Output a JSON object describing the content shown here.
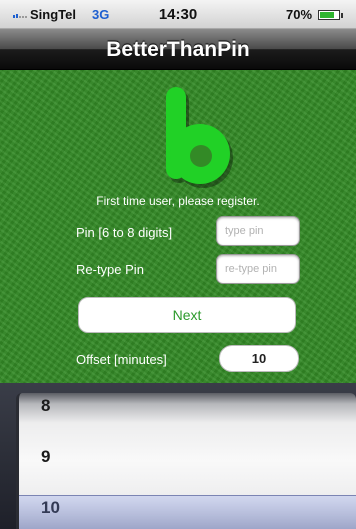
{
  "status_bar": {
    "carrier": "SingTel",
    "network": "3G",
    "time": "14:30",
    "battery": "70%",
    "battery_level": 0.7
  },
  "nav": {
    "title": "BetterThanPin"
  },
  "logo": {
    "icon": "app-logo-b",
    "color": "#21d126"
  },
  "form": {
    "register_message": "First time user, please register.",
    "pin_label": "Pin [6 to 8 digits]",
    "pin_placeholder": "type pin",
    "retype_label": "Re-type Pin",
    "retype_placeholder": "re-type pin",
    "next_label": "Next",
    "offset_label": "Offset [minutes]",
    "offset_value": "10"
  },
  "picker": {
    "items": [
      "8",
      "9",
      "10"
    ],
    "selected": "10"
  },
  "colors": {
    "background_green": "#338a26",
    "accent_green": "#2c9a2c",
    "logo_green": "#21d126",
    "network_blue": "#1d5fd0"
  }
}
